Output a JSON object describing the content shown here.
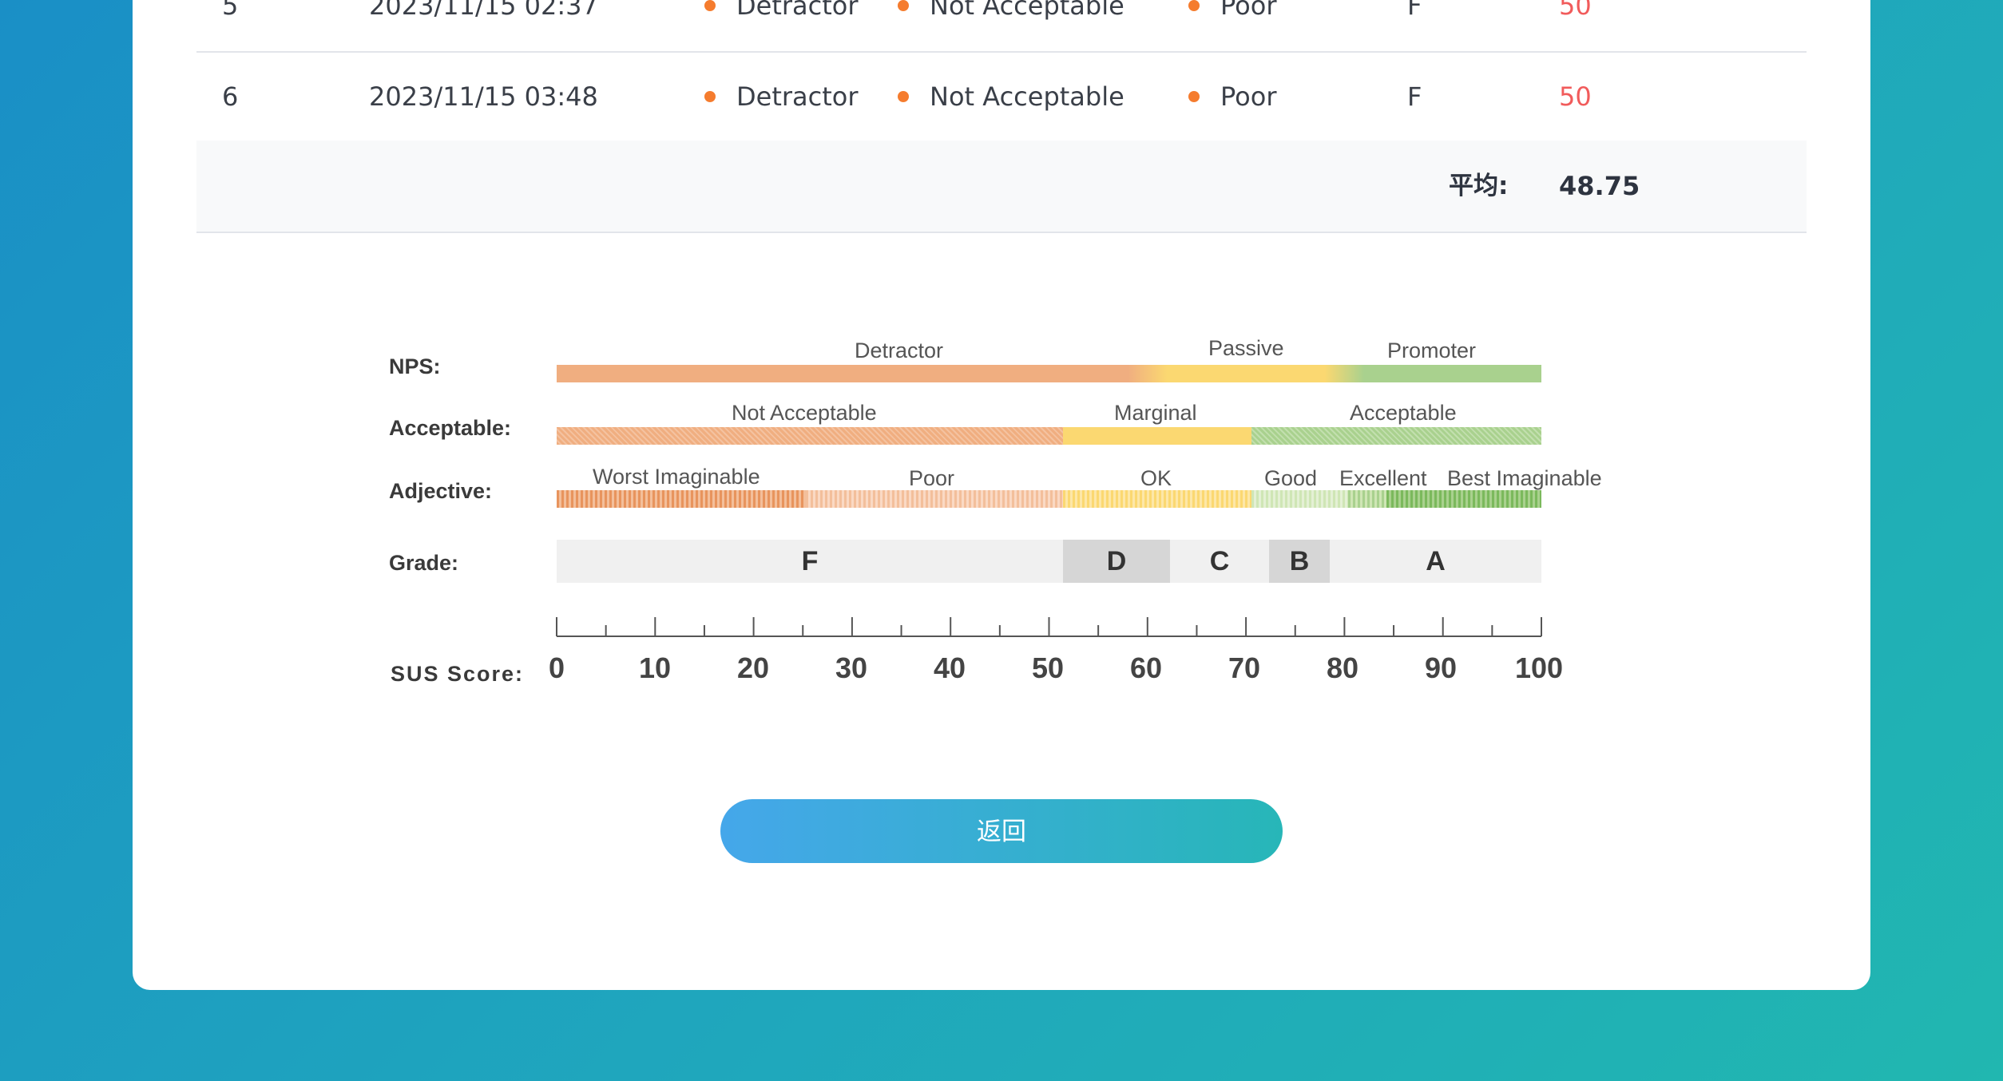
{
  "table": {
    "rows": [
      {
        "index": "5",
        "time": "2023/11/15 02:37",
        "nps": "Detractor",
        "acceptable": "Not Acceptable",
        "adjective": "Poor",
        "grade": "F",
        "score": "50"
      },
      {
        "index": "6",
        "time": "2023/11/15 03:48",
        "nps": "Detractor",
        "acceptable": "Not Acceptable",
        "adjective": "Poor",
        "grade": "F",
        "score": "50"
      }
    ],
    "average_label": "平均:",
    "average_value": "48.75"
  },
  "scale": {
    "row_labels": {
      "nps": "NPS:",
      "acceptable": "Acceptable:",
      "adjective": "Adjective:",
      "grade": "Grade:",
      "sus": "SUS Score:"
    },
    "nps": [
      "Detractor",
      "Passive",
      "Promoter"
    ],
    "acceptable": [
      "Not Acceptable",
      "Marginal",
      "Acceptable"
    ],
    "adjective": [
      "Worst Imaginable",
      "Poor",
      "OK",
      "Good",
      "Excellent",
      "Best Imaginable"
    ],
    "grades": [
      "F",
      "D",
      "C",
      "B",
      "A"
    ],
    "sus_ticks": [
      "0",
      "10",
      "20",
      "30",
      "40",
      "50",
      "60",
      "70",
      "80",
      "90",
      "100"
    ],
    "colors": {
      "orange": "#f0ae80",
      "yellow": "#fbd871",
      "green": "#a9d18e",
      "grade_bg": "#f0f0f0",
      "grade_dark": "#d6d6d6"
    }
  },
  "back_button": "返回"
}
